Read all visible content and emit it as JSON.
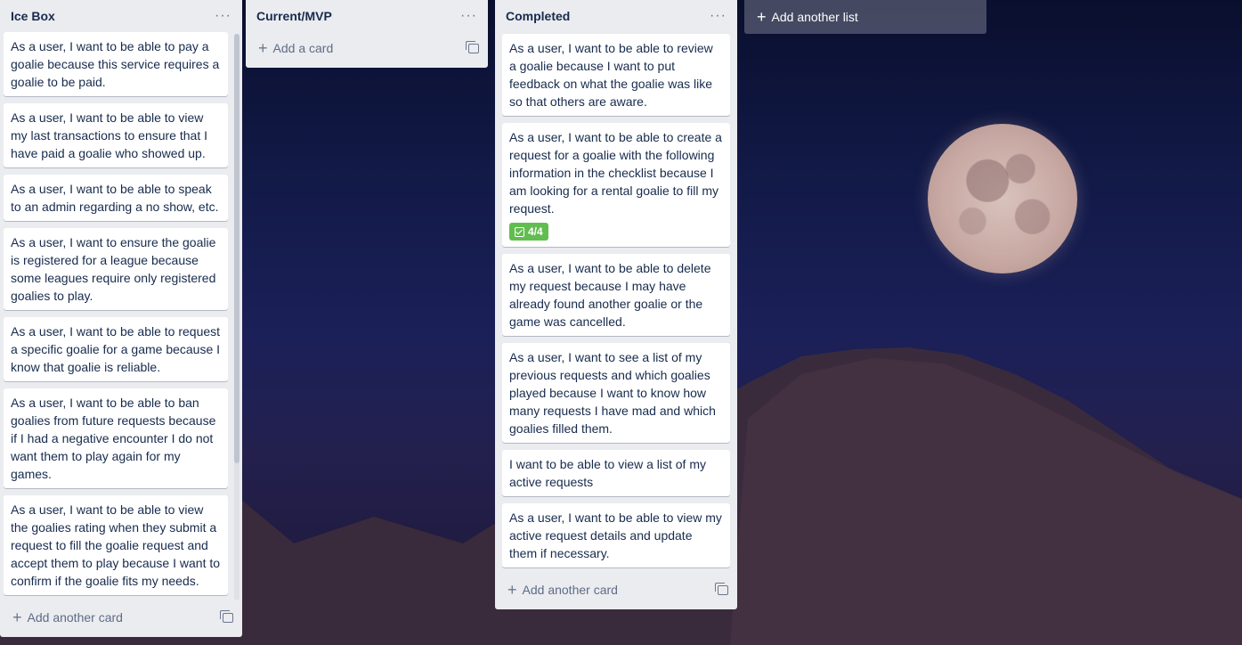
{
  "lists": [
    {
      "title": "Ice Box",
      "cards": [
        {
          "text": "As a user, I want to be able to pay a goalie because this service requires a goalie to be paid."
        },
        {
          "text": "As a user, I want to be able to view my last transactions to ensure that I have paid a goalie who showed up."
        },
        {
          "text": "As a user, I want to be able to speak to an admin regarding a no show, etc."
        },
        {
          "text": "As a user, I want to ensure the goalie is registered for a league because some leagues require only registered goalies to play."
        },
        {
          "text": "As a user, I want to be able to request a specific goalie for a game because I know that goalie is reliable."
        },
        {
          "text": "As a user, I want to be able to ban goalies from future requests because if I had a negative encounter I do not want them to play again for my games."
        },
        {
          "text": "As a user, I want to be able to view the goalies rating when they submit a request to fill the goalie request and accept them to play because I want to confirm if the goalie fits my needs."
        }
      ],
      "add_label": "Add another card"
    },
    {
      "title": "Current/MVP",
      "cards": [],
      "add_label": "Add a card"
    },
    {
      "title": "Completed",
      "cards": [
        {
          "text": "As a user, I want to be able to review a goalie because I want to put feedback on what the goalie was like so that others are aware."
        },
        {
          "text": "As a user, I want to be able to create a request for a goalie with the following information in the checklist because I am looking for a rental goalie to fill my request.",
          "badge": "4/4"
        },
        {
          "text": "As a user, I want to be able to delete my request because I may have already found another goalie or the game was cancelled."
        },
        {
          "text": "As a user, I want to see a list of my previous requests and which goalies played because I want to know how many requests I have mad and which goalies filled them."
        },
        {
          "text": "I want to be able to view a list of my active requests"
        },
        {
          "text": "As a user, I want to be able to view my active request details and update them if necessary."
        }
      ],
      "add_label": "Add another card"
    }
  ],
  "add_list_label": "Add another list",
  "menu_glyph": "···",
  "colors": {
    "list_bg": "#ebecf0",
    "badge_complete": "#61bd4f",
    "title_text": "#172b4d"
  }
}
